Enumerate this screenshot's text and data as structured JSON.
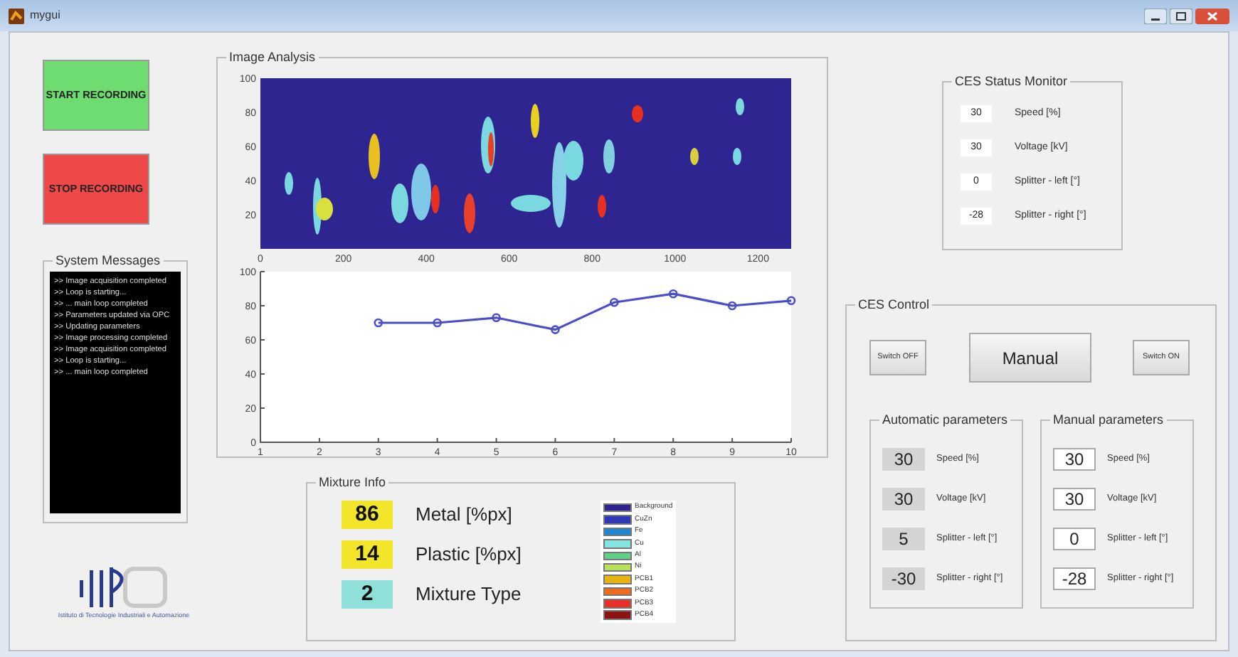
{
  "window": {
    "title": "mygui"
  },
  "recording": {
    "start": "START RECORDING",
    "stop": "STOP RECORDING"
  },
  "system_messages": {
    "title": "System Messages",
    "lines": [
      ">> Image acquisition completed",
      ">> Loop is starting...",
      ">> ... main loop completed",
      ">> Parameters updated via OPC",
      ">> Updating parameters",
      ">> Image processing completed",
      ">> Image acquisition completed",
      ">> Loop is starting...",
      ">> ... main loop completed"
    ]
  },
  "logo": {
    "caption": "Istituto di Tecnologie Industriali e Automazione"
  },
  "image_analysis": {
    "title": "Image Analysis",
    "image": {
      "kind": "picture",
      "xticks": [
        "0",
        "200",
        "400",
        "600",
        "800",
        "1000",
        "1200"
      ],
      "yticks": [
        "100",
        "80",
        "60",
        "40",
        "20"
      ]
    },
    "chart_data": {
      "type": "line",
      "x": [
        3,
        4,
        5,
        6,
        7,
        8,
        9,
        10
      ],
      "series": [
        {
          "color": "#4a4ec8",
          "marker": "o",
          "values": [
            70,
            70,
            73,
            66,
            82,
            87,
            80,
            83
          ]
        }
      ],
      "xlim": [
        1,
        10
      ],
      "ylim": [
        0,
        100
      ],
      "xticks": [
        1,
        2,
        3,
        4,
        5,
        6,
        7,
        8,
        9,
        10
      ],
      "yticks": [
        0,
        20,
        40,
        60,
        80,
        100
      ]
    }
  },
  "mixture_info": {
    "title": "Mixture Info",
    "items": [
      {
        "value": "86",
        "label": "Metal [%px]",
        "color": "#f2e52a"
      },
      {
        "value": "14",
        "label": "Plastic [%px]",
        "color": "#f2e52a"
      },
      {
        "value": "2",
        "label": "Mixture Type",
        "color": "#8fe0d8"
      }
    ],
    "legend": [
      {
        "label": "Background",
        "color": "#2f2590"
      },
      {
        "label": "CuZn",
        "color": "#3038b8"
      },
      {
        "label": "Fe",
        "color": "#1f86d2"
      },
      {
        "label": "Cu",
        "color": "#86e4e0"
      },
      {
        "label": "Al",
        "color": "#5ed08a"
      },
      {
        "label": "Ni",
        "color": "#b8e05a"
      },
      {
        "label": "PCB1",
        "color": "#e8b410"
      },
      {
        "label": "PCB2",
        "color": "#ee6a1c"
      },
      {
        "label": "PCB3",
        "color": "#e8302a"
      },
      {
        "label": "PCB4",
        "color": "#8a1414"
      }
    ]
  },
  "status_monitor": {
    "title": "CES Status Monitor",
    "rows": [
      {
        "value": "30",
        "label": "Speed [%]"
      },
      {
        "value": "30",
        "label": "Voltage [kV]"
      },
      {
        "value": "0",
        "label": "Splitter - left [°]"
      },
      {
        "value": "-28",
        "label": "Splitter - right [°]"
      }
    ]
  },
  "ces_control": {
    "title": "CES Control",
    "switch_off": "Switch OFF",
    "mode": "Manual",
    "switch_on": "Switch ON",
    "groups": [
      {
        "title": "Automatic parameters",
        "disabled": true,
        "rows": [
          {
            "value": "30",
            "label": "Speed [%]"
          },
          {
            "value": "30",
            "label": "Voltage [kV]"
          },
          {
            "value": "5",
            "label": "Splitter - left [°]"
          },
          {
            "value": "-30",
            "label": "Splitter - right [°]"
          }
        ]
      },
      {
        "title": "Manual parameters",
        "disabled": false,
        "rows": [
          {
            "value": "30",
            "label": "Speed [%]"
          },
          {
            "value": "30",
            "label": "Voltage [kV]"
          },
          {
            "value": "0",
            "label": "Splitter - left [°]"
          },
          {
            "value": "-28",
            "label": "Splitter - right [°]"
          }
        ]
      }
    ]
  }
}
